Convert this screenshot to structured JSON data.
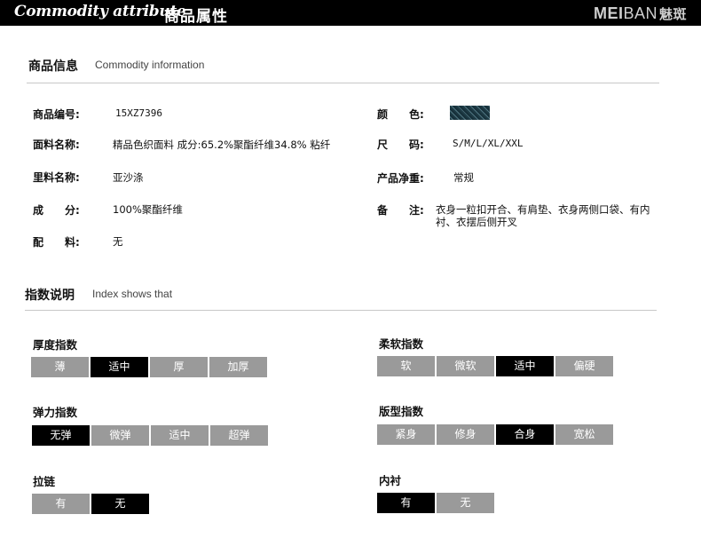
{
  "header": {
    "title_en": "Commodity attribute",
    "title_zh": "商品属性",
    "logo_bold": "MEI",
    "logo_thin": "BAN",
    "logo_zh": "魅斑"
  },
  "info": {
    "title": "商品信息",
    "subtitle": "Commodity information",
    "left": [
      {
        "label": "商品编号:",
        "value": "15XZ7396"
      },
      {
        "label": "面料名称:",
        "value": "精品色织面料 成分:65.2%聚酯纤维34.8% 粘纤"
      },
      {
        "label": "里料名称:",
        "value": "亚沙涤"
      },
      {
        "label": "成　　分:",
        "value": "100%聚酯纤维"
      },
      {
        "label": "配　　料:",
        "value": "无"
      }
    ],
    "right": [
      {
        "label": "颜　　色:",
        "value": ""
      },
      {
        "label": "尺　　码:",
        "value": "S/M/L/XL/XXL"
      },
      {
        "label": "产品净重:",
        "value": "常规"
      },
      {
        "label": "备　　注:",
        "value": "衣身一粒扣开合、有肩垫、衣身两侧口袋、有内衬、衣摆后侧开叉"
      }
    ],
    "color_swatch": "dark teal herringbone"
  },
  "index": {
    "title": "指数说明",
    "subtitle": "Index shows that",
    "groups": [
      {
        "title": "厚度指数",
        "options": [
          "薄",
          "适中",
          "厚",
          "加厚"
        ],
        "selected": 1
      },
      {
        "title": "柔软指数",
        "options": [
          "软",
          "微软",
          "适中",
          "偏硬"
        ],
        "selected": 2
      },
      {
        "title": "弹力指数",
        "options": [
          "无弹",
          "微弹",
          "适中",
          "超弹"
        ],
        "selected": 0
      },
      {
        "title": "版型指数",
        "options": [
          "紧身",
          "修身",
          "合身",
          "宽松"
        ],
        "selected": 2
      },
      {
        "title": "拉链",
        "options": [
          "有",
          "无"
        ],
        "selected": 1
      },
      {
        "title": "内衬",
        "options": [
          "有",
          "无"
        ],
        "selected": 0
      }
    ]
  },
  "colors": {
    "active": "#000000",
    "inactive": "#9a9a9a",
    "bar": "#000000"
  }
}
